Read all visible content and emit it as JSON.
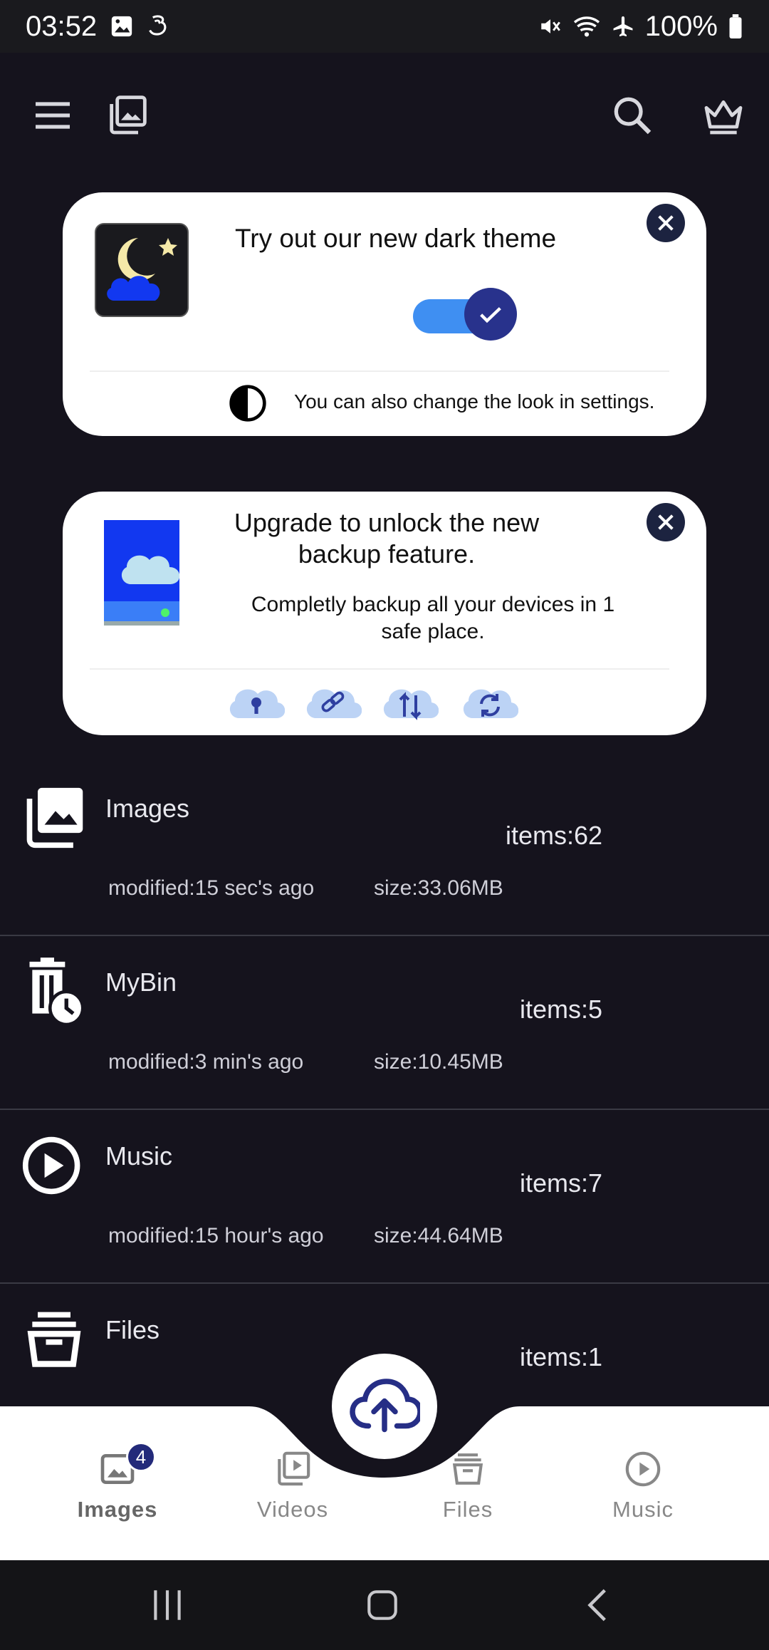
{
  "status_bar": {
    "time": "03:52",
    "battery": "100%",
    "icons": [
      "image-icon",
      "carrier-icon",
      "mute-icon",
      "wifi-icon",
      "airplane-icon",
      "battery-icon"
    ]
  },
  "toolbar": {
    "icons": [
      "menu-icon",
      "gallery-icon",
      "search-icon",
      "crown-icon"
    ]
  },
  "theme_card": {
    "title": "Try out our new dark theme",
    "hint": "You can also change the look in settings.",
    "toggle_on": true
  },
  "upgrade_card": {
    "title": "Upgrade to unlock the new backup feature.",
    "subtitle": "Completly backup all your devices in 1 safe place.",
    "feature_icons": [
      "cloud-lock-icon",
      "cloud-link-icon",
      "cloud-transfer-icon",
      "cloud-sync-icon"
    ]
  },
  "folders": [
    {
      "name": "Images",
      "items": "items:62",
      "modified": "modified:15 sec's ago",
      "size": "size:33.06MB"
    },
    {
      "name": "MyBin",
      "items": "items:5",
      "modified": "modified:3 min's ago",
      "size": "size:10.45MB"
    },
    {
      "name": "Music",
      "items": "items:7",
      "modified": "modified:15 hour's ago",
      "size": "size:44.64MB"
    },
    {
      "name": "Files",
      "items": "items:1"
    }
  ],
  "bottom_nav": {
    "items": [
      {
        "label": "Images",
        "badge": "4"
      },
      {
        "label": "Videos"
      },
      {
        "label": "Files"
      },
      {
        "label": "Music"
      }
    ]
  },
  "colors": {
    "background": "#15131d",
    "accent": "#28328c",
    "toggle_track": "#3f8ff2"
  }
}
